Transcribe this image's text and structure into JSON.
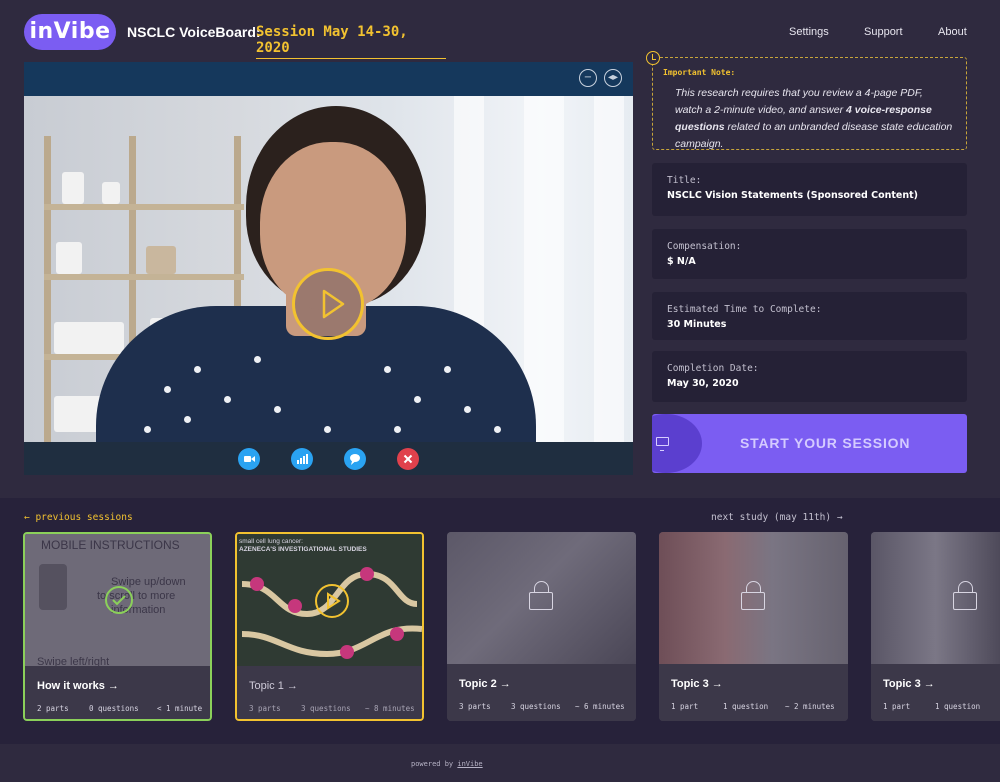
{
  "header": {
    "logo_text": "inVibe",
    "app_title": "NSCLC VoiceBoard:",
    "session_title": "Session May 14-30, 2020",
    "nav": [
      "Settings",
      "Support",
      "About"
    ]
  },
  "video": {
    "minimize_icon": "minus-circle-icon",
    "expand_icon": "expand-arrows-icon",
    "play_icon": "play-icon",
    "controls": [
      {
        "icon": "camera-icon",
        "glyph": "▮",
        "color": "#2aa3f2"
      },
      {
        "icon": "signal-icon",
        "glyph": "▮",
        "color": "#2aa3f2"
      },
      {
        "icon": "chat-icon",
        "glyph": "●",
        "color": "#2aa3f2"
      },
      {
        "icon": "close-icon",
        "glyph": "✕",
        "color": "#e0414c"
      }
    ]
  },
  "note": {
    "label": "Important Note:",
    "text_part1": "This research requires that you review a 4-page PDF, watch a 2-minute video, and answer ",
    "text_bold": "4 voice-response questions",
    "text_part2": " related to an unbranded disease state education campaign."
  },
  "info": [
    {
      "label": "Title:",
      "value": "NSCLC Vision Statements (Sponsored Content)"
    },
    {
      "label": "Compensation:",
      "value": "$ N/A"
    },
    {
      "label": "Estimated Time to Complete:",
      "value": "30 Minutes"
    },
    {
      "label": "Completion Date:",
      "value": "May 30, 2020"
    }
  ],
  "start_button": {
    "label": "START YOUR SESSION"
  },
  "sessions": {
    "prev_label": "← previous sessions",
    "next_label": "next study (may 11th) →",
    "cards": [
      {
        "title": "How it works →",
        "parts": "2 parts",
        "questions": "0 questions",
        "time": "< 1 minute",
        "state": "completed",
        "img_lines": [
          "MOBILE INSTRUCTIONS",
          "Swipe up/down",
          "to scroll to more",
          "information",
          "Swipe left/right"
        ]
      },
      {
        "title": "Topic 1 →",
        "parts": "3 parts",
        "questions": "3 questions",
        "time": "~ 8 minutes",
        "state": "active",
        "img_lines": [
          "small cell lung cancer:",
          "AZENECA'S INVESTIGATIONAL STUDIES"
        ]
      },
      {
        "title": "Topic 2 →",
        "parts": "3 parts",
        "questions": "3 questions",
        "time": "~ 6 minutes",
        "state": "locked",
        "img_lines": []
      },
      {
        "title": "Topic 3 →",
        "parts": "1 part",
        "questions": "1 question",
        "time": "~ 2 minutes",
        "state": "locked",
        "img_lines": []
      },
      {
        "title": "Topic 3 →",
        "parts": "1 part",
        "questions": "1 question",
        "time": "",
        "state": "locked",
        "img_lines": []
      }
    ]
  },
  "footer": {
    "powered_prefix": "powered by ",
    "powered_brand": "inVibe"
  },
  "colors": {
    "accent": "#7b5df2",
    "gold": "#f2c230",
    "green": "#8bd05a",
    "background": "#2f2a3f"
  }
}
